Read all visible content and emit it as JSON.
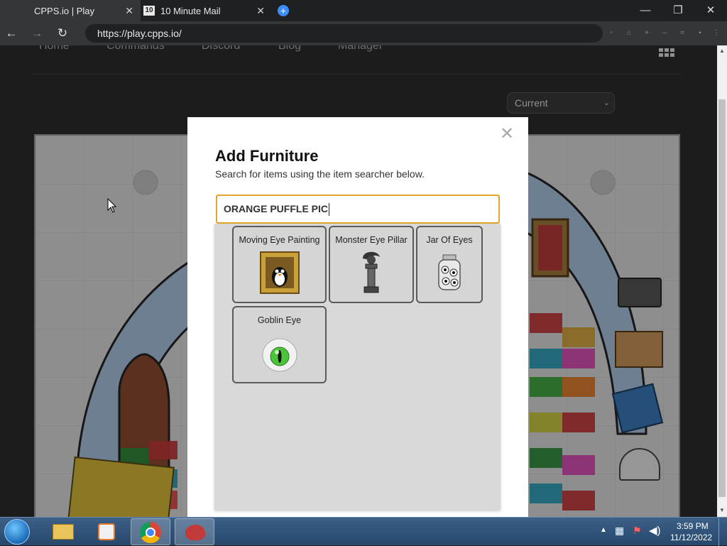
{
  "browser": {
    "tabs": [
      {
        "title": "CPPS.io | Play",
        "active": true
      },
      {
        "title": "10 Minute Mail",
        "active": false,
        "favicon_text": "10"
      }
    ],
    "url": "https://play.cpps.io/"
  },
  "site": {
    "nav": [
      "Home",
      "Commands",
      "Discord",
      "Blog",
      "Manager"
    ],
    "version_select": "Current"
  },
  "modal": {
    "title": "Add Furniture",
    "subtitle": "Search for items using the item searcher below.",
    "search_value": "ORANGE PUFFLE PIC",
    "results": [
      {
        "label": "Moving Eye Painting",
        "icon": "painting-icon"
      },
      {
        "label": "Monster Eye Pillar",
        "icon": "pillar-icon"
      },
      {
        "label": "Jar Of Eyes",
        "icon": "jar-icon"
      },
      {
        "label": "Goblin Eye",
        "icon": "eye-icon"
      }
    ]
  },
  "taskbar": {
    "time": "3:59 PM",
    "date": "11/12/2022"
  },
  "colors": {
    "search_border": "#e4a52b",
    "chrome_tab_active": "#35363a"
  }
}
